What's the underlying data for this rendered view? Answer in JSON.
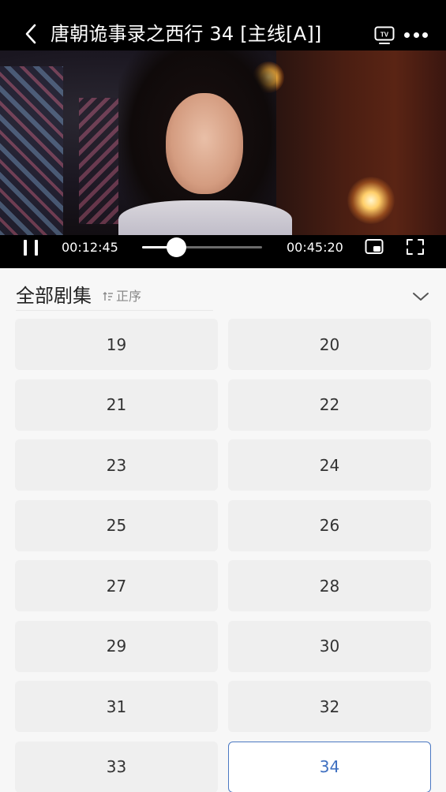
{
  "player": {
    "title": "唐朝诡事录之西行 34 [主线[A]]",
    "current_time": "00:12:45",
    "total_time": "00:45:20",
    "progress": 0.283,
    "icons": [
      "back-icon",
      "tv-cast-icon",
      "more-icon",
      "pause-icon",
      "pip-icon",
      "fullscreen-icon"
    ]
  },
  "episodes": {
    "title": "全部剧集",
    "sort_label": "正序",
    "items": [
      "19",
      "20",
      "21",
      "22",
      "23",
      "24",
      "25",
      "26",
      "27",
      "28",
      "29",
      "30",
      "31",
      "32",
      "33",
      "34"
    ],
    "active": "34"
  },
  "colors": {
    "accent": "#3e6fc0",
    "tile_bg": "#efefef",
    "panel_bg": "#f7f7f7"
  }
}
